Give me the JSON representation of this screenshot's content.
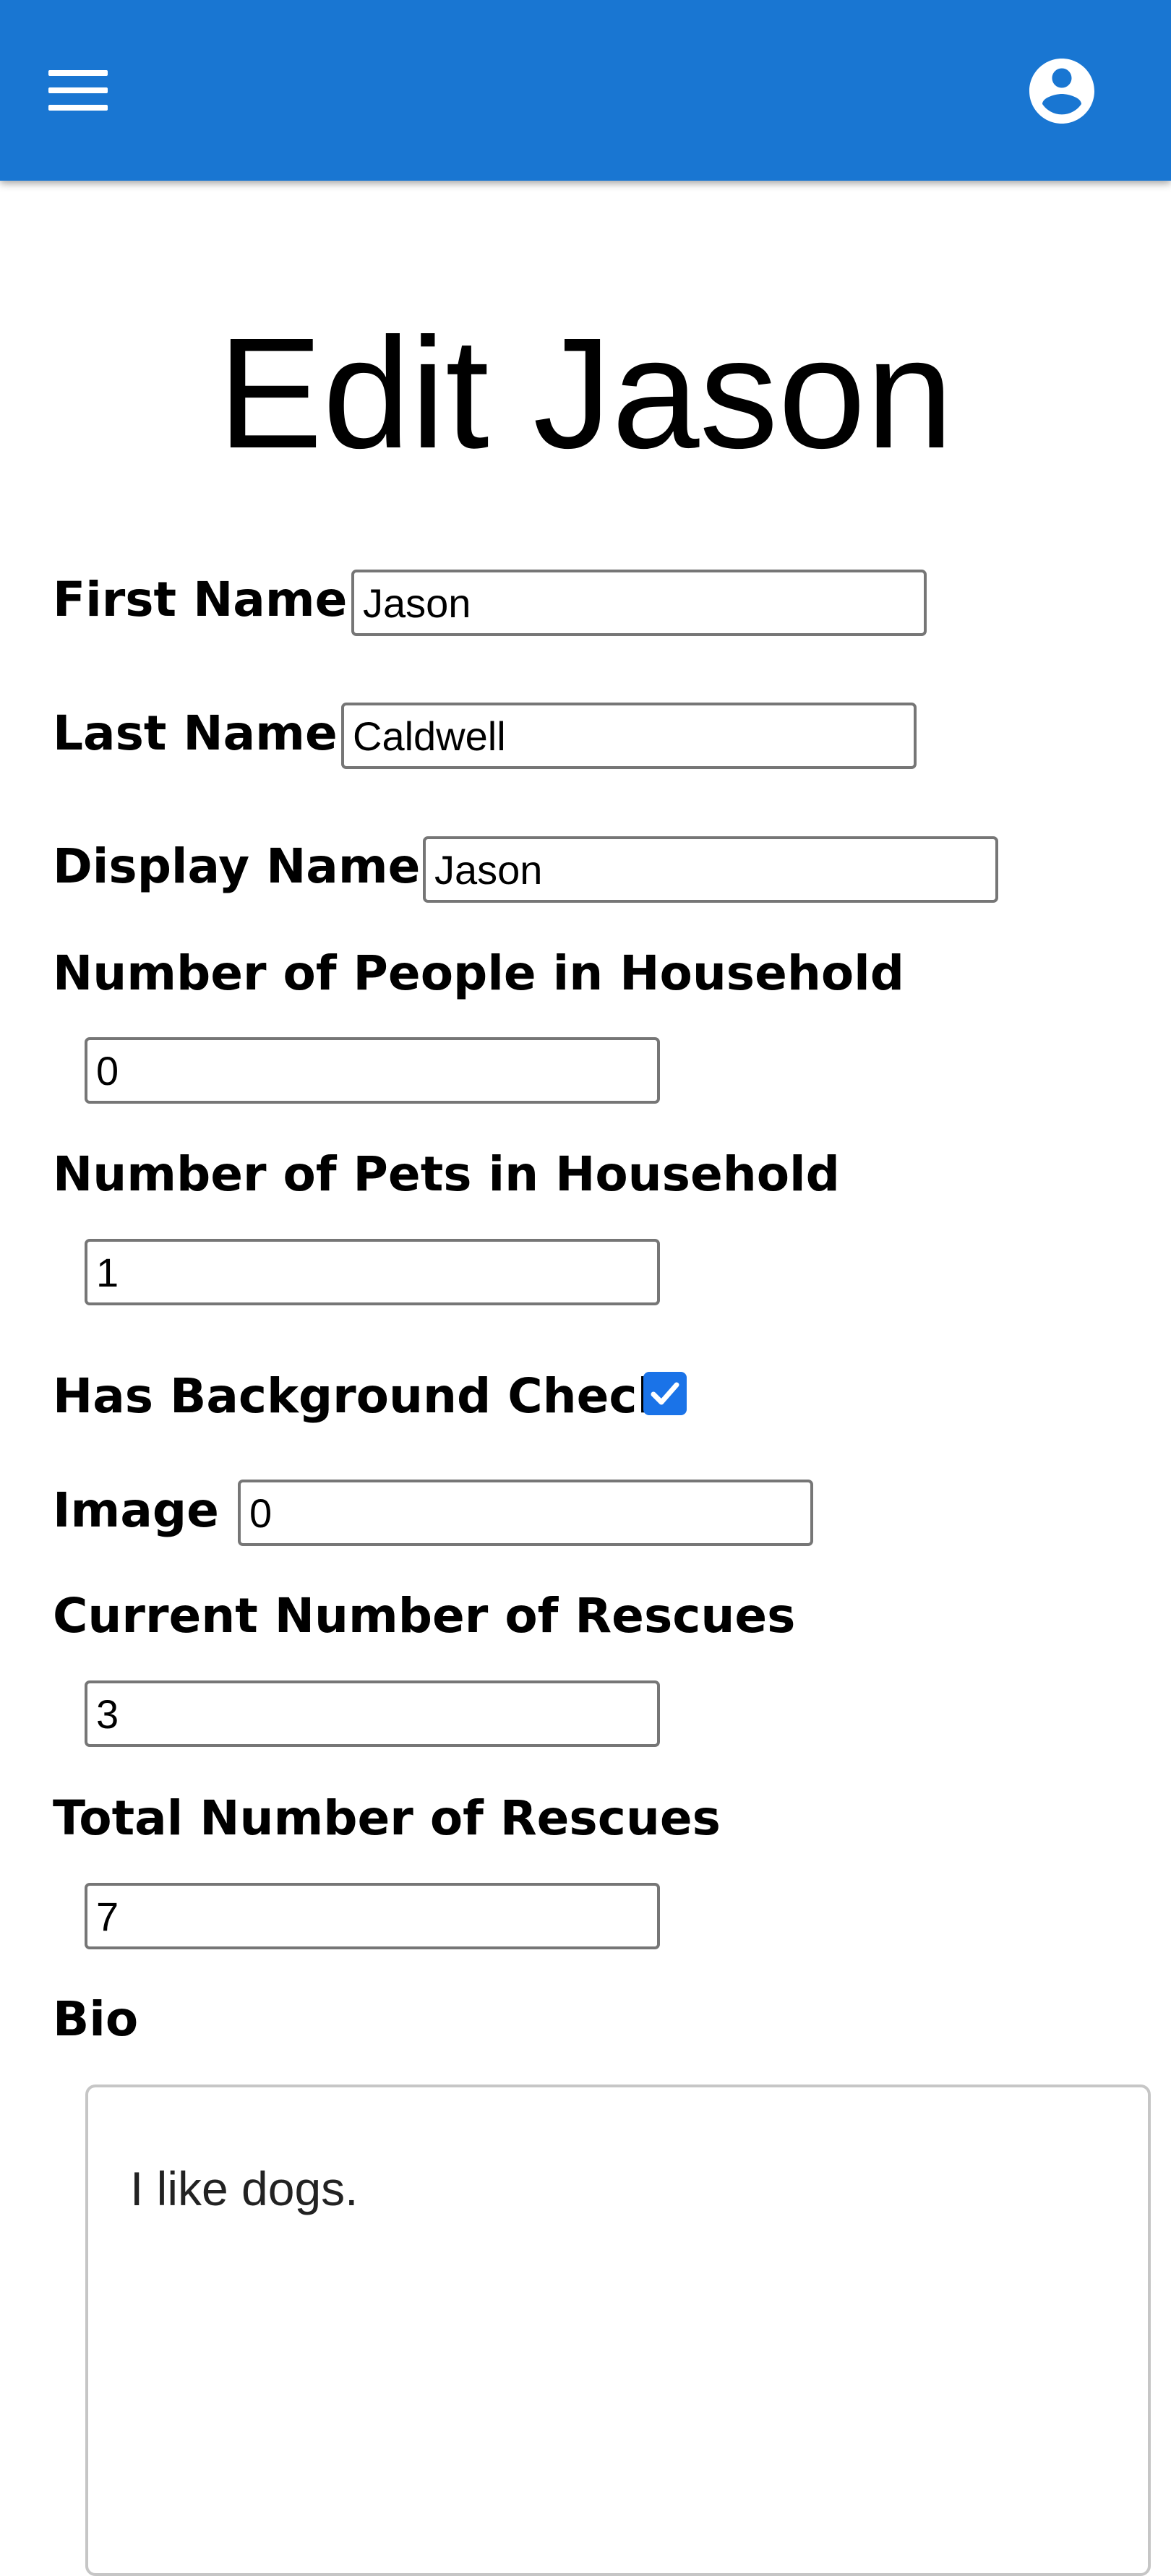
{
  "header": {
    "menu_icon": "hamburger-menu-icon",
    "account_icon": "account-circle-icon",
    "background_color": "#1976d2"
  },
  "page": {
    "title": "Edit Jason"
  },
  "form": {
    "first_name": {
      "label": "First Name",
      "value": "Jason"
    },
    "last_name": {
      "label": "Last Name",
      "value": "Caldwell"
    },
    "display_name": {
      "label": "Display Name",
      "value": "Jason"
    },
    "people_in_household": {
      "label": "Number of People in Household",
      "value": "0"
    },
    "pets_in_household": {
      "label": "Number of Pets in Household",
      "value": "1"
    },
    "background_check": {
      "label": "Has Background Check",
      "checked": true
    },
    "image": {
      "label": "Image",
      "value": "0"
    },
    "current_rescues": {
      "label": "Current Number of Rescues",
      "value": "3"
    },
    "total_rescues": {
      "label": "Total Number of Rescues",
      "value": "7"
    },
    "bio": {
      "label": "Bio",
      "value": "I like dogs."
    }
  },
  "colors": {
    "accent": "#1976d2",
    "checkbox": "#1a73e8",
    "input_border": "#767676"
  }
}
